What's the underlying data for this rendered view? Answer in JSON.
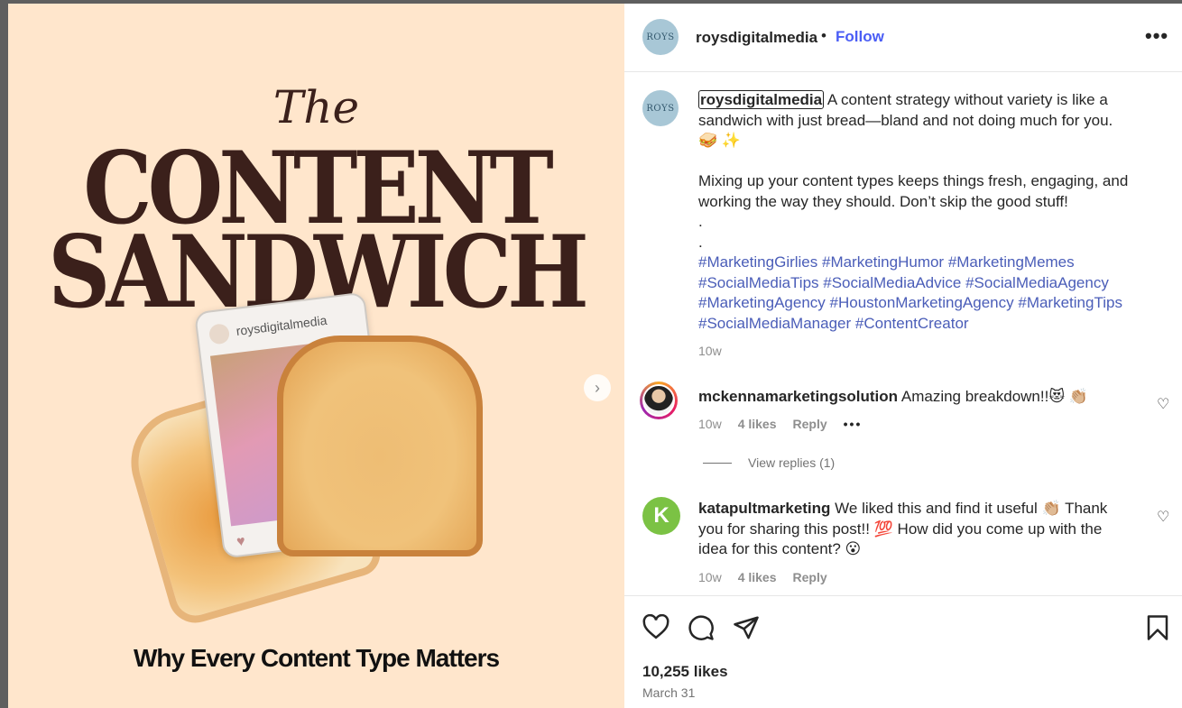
{
  "media": {
    "title_the": "The",
    "title_content": "CONTENT",
    "title_sandwich": "SANDWICH",
    "phone_username": "roysdigitalmedia",
    "subtitle": "Why Every Content Type Matters",
    "next_icon": "chevron-right-icon"
  },
  "header": {
    "avatar_text": "ROYS",
    "username": "roysdigitalmedia",
    "dot": "•",
    "follow": "Follow",
    "more": "•••"
  },
  "caption": {
    "avatar_text": "ROYS",
    "username": "roysdigitalmedia",
    "line1": "A content strategy without variety is like a sandwich with just bread—bland and not doing much for you.",
    "emoji": "🥪 ✨",
    "line2": "Mixing up your content types keeps things fresh, engaging, and working the way they should. Don’t skip the good stuff!",
    "dot1": ".",
    "dot2": ".",
    "hashtags": "#MarketingGirlies #MarketingHumor #MarketingMemes #SocialMediaTips #SocialMediaAdvice #SocialMediaAgency #MarketingAgency #HoustonMarketingAgency #MarketingTips #SocialMediaManager #ContentCreator",
    "time": "10w"
  },
  "comments": [
    {
      "username": "mckennamarketingsolution",
      "text": "Amazing breakdown!!😻 👏🏼",
      "time": "10w",
      "likes": "4 likes",
      "reply": "Reply",
      "more": "•••",
      "view_replies": "View replies (1)"
    },
    {
      "username": "katapultmarketing",
      "text": "We liked this and find it useful 👏🏼 Thank you for sharing this post!! 💯 How did you come up with the idea for this content? 😮",
      "time": "10w",
      "likes": "4 likes",
      "reply": "Reply"
    }
  ],
  "footer": {
    "likes": "10,255 likes",
    "date": "March 31"
  },
  "colors": {
    "follow": "#4a5df5",
    "hashtag": "#4a5db8",
    "media_bg": "#ffe6cc",
    "title": "#3b201b"
  }
}
